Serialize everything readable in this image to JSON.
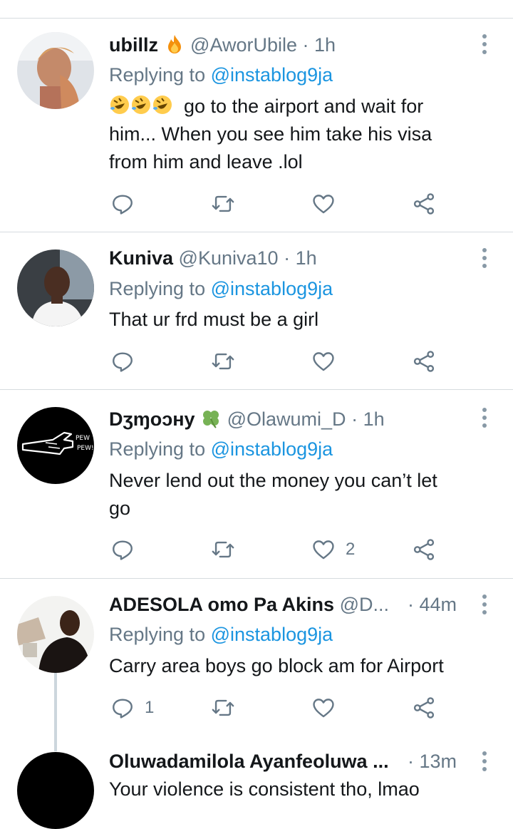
{
  "tweets": [
    {
      "name": "ubillz",
      "name_emoji": "fire-emoji",
      "handle": "@AworUbile",
      "dot": "·",
      "time": "1h",
      "replying_prefix": "Replying to",
      "replying_to": "@instablog9ja",
      "text_lead_emojis": [
        "rofl-emoji",
        "rofl-emoji",
        "rofl-emoji"
      ],
      "text_line1": "go to the airport and wait for",
      "text_line2": "him... When you see him take his visa",
      "text_line3": "from him and leave .lol",
      "reply_count": "",
      "like_count": ""
    },
    {
      "name": "Kuniva",
      "handle": "@Kuniva10",
      "dot": "·",
      "time": "1h",
      "replying_prefix": "Replying to",
      "replying_to": "@instablog9ja",
      "text_line1": "That ur frd must be a girl",
      "reply_count": "",
      "like_count": ""
    },
    {
      "name": "Dʒɱoɔнy",
      "name_emoji": "four-leaf-clover-emoji",
      "handle": "@Olawumi_D",
      "dot": "·",
      "time": "1h",
      "replying_prefix": "Replying to",
      "replying_to": "@instablog9ja",
      "text_line1": "Never lend out the money you can’t let",
      "text_line2": "go",
      "reply_count": "",
      "like_count": "2"
    },
    {
      "name": "ADESOLA omo Pa Akins",
      "handle": "@D...",
      "dot": "·",
      "time": "44m",
      "replying_prefix": "Replying to",
      "replying_to": "@instablog9ja",
      "text_line1": "Carry area boys go block am for Airport",
      "reply_count": "1",
      "like_count": ""
    },
    {
      "name": "Oluwadamilola Ayanfeoluwa ...",
      "handle": "",
      "dot": "·",
      "time": "13m",
      "text_line1": "Your violence is consistent tho, lmao"
    }
  ],
  "icons": {
    "reply": "reply-icon",
    "retweet": "retweet-icon",
    "like": "heart-icon",
    "share": "share-icon",
    "more": "more-vertical-icon"
  },
  "colors": {
    "link": "#1b95e0",
    "secondary": "#657786",
    "divider": "#d6dbdf"
  }
}
